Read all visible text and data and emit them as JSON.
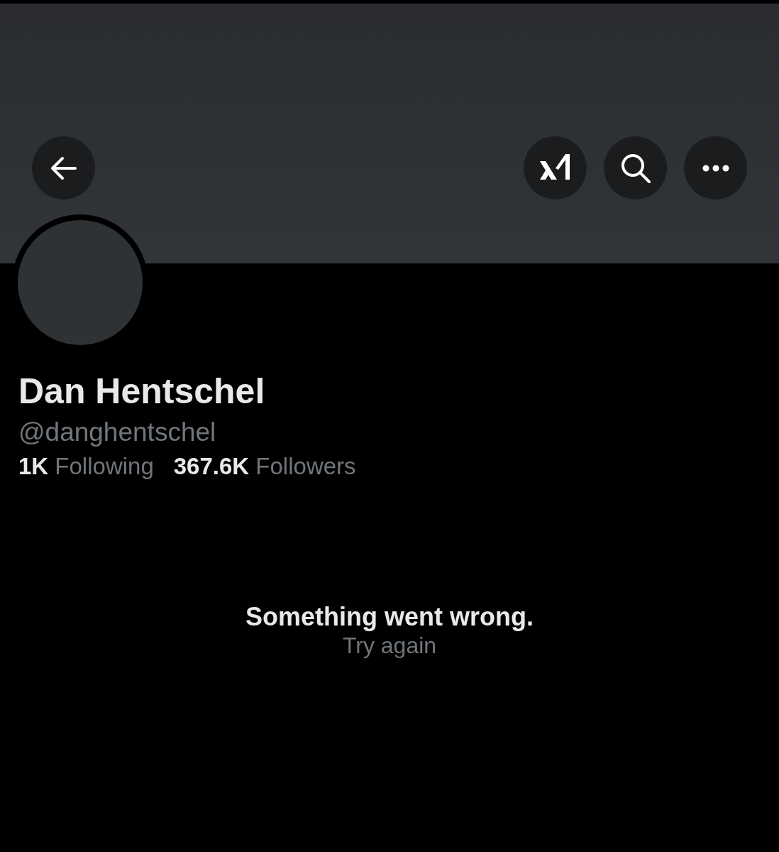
{
  "profile": {
    "name": "Dan Hentschel",
    "handle": "@danghentschel"
  },
  "stats": [
    {
      "count": "1K",
      "label": "Following"
    },
    {
      "count": "367.6K",
      "label": "Followers"
    }
  ],
  "error": {
    "message": "Something went wrong.",
    "action": "Try again"
  }
}
